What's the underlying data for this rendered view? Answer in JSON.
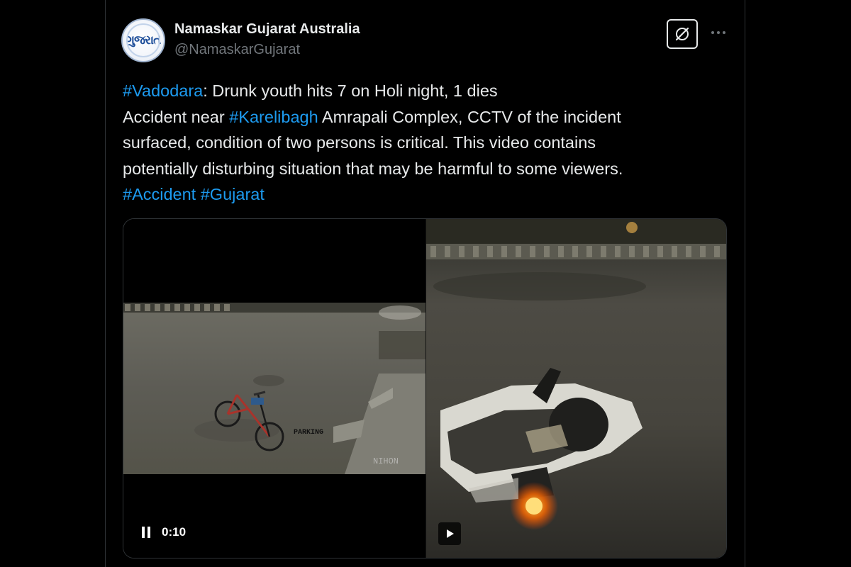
{
  "account": {
    "display_name": "Namaskar Gujarat Australia",
    "handle": "@NamaskarGujarat",
    "avatar_logo_text": "ગુજરાત"
  },
  "tweet": {
    "lines": [
      [
        {
          "text": "#Vadodara",
          "hashtag": true
        },
        {
          "text": ": Drunk youth hits 7 on Holi night, 1 dies",
          "hashtag": false
        }
      ],
      [
        {
          "text": "Accident near ",
          "hashtag": false
        },
        {
          "text": "#Karelibagh",
          "hashtag": true
        },
        {
          "text": " Amrapali Complex, CCTV of the incident",
          "hashtag": false
        }
      ],
      [
        {
          "text": "surfaced, condition of two persons is critical. This video contains",
          "hashtag": false
        }
      ],
      [
        {
          "text": "potentially disturbing situation that may be harmful to some viewers.",
          "hashtag": false
        }
      ],
      [
        {
          "text": "#Accident",
          "hashtag": true
        },
        {
          "text": " ",
          "hashtag": false
        },
        {
          "text": "#Gujarat",
          "hashtag": true
        }
      ]
    ]
  },
  "media": {
    "left_video": {
      "timestamp": "0:10",
      "state_icon": "pause-icon",
      "overlay_text": "PARKING",
      "watermark": "NIHON"
    },
    "right_video": {
      "state_icon": "play-icon"
    }
  },
  "colors": {
    "background": "#000000",
    "text_primary": "#e7e9ea",
    "text_secondary": "#71767b",
    "hashtag": "#1d9bf0",
    "border": "#2f3336"
  },
  "icons": {
    "grok": "grok-icon",
    "more": "more-options-icon"
  }
}
